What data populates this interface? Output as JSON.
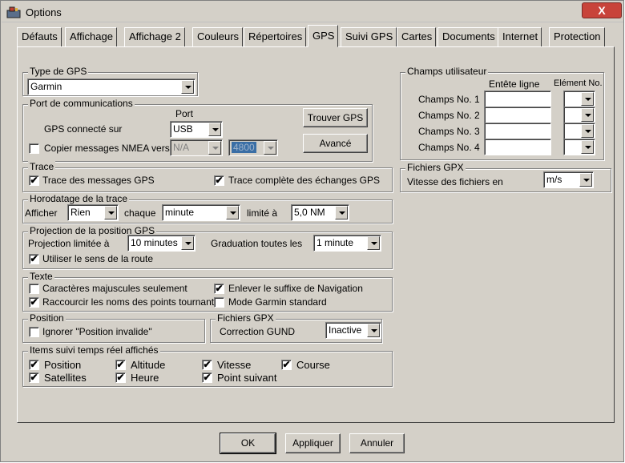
{
  "window": {
    "title": "Options",
    "close_label": "X"
  },
  "tabs": [
    {
      "label": "Défauts"
    },
    {
      "label": "Affichage"
    },
    {
      "label": "Affichage 2"
    },
    {
      "label": "Couleurs"
    },
    {
      "label": "Répertoires"
    },
    {
      "label": "GPS"
    },
    {
      "label": "Suivi GPS"
    },
    {
      "label": "Cartes"
    },
    {
      "label": "Documents"
    },
    {
      "label": "Internet"
    },
    {
      "label": "Protection"
    }
  ],
  "active_tab": "GPS",
  "gps_type": {
    "legend": "Type de GPS",
    "value": "Garmin"
  },
  "port": {
    "legend": "Port de communications",
    "port_header": "Port",
    "connected_label": "GPS connecté sur",
    "port_value": "USB",
    "copy_nmea_label": "Copier messages NMEA vers",
    "copy_nmea_checked": false,
    "nmea_port_value": "N/A",
    "nmea_speed_value": "4800",
    "find_button": "Trouver GPS",
    "advanced_button": "Avancé"
  },
  "trace": {
    "legend": "Trace",
    "gps_messages_label": "Trace des messages GPS",
    "gps_messages_checked": true,
    "full_trace_label": "Trace complète des échanges GPS",
    "full_trace_checked": true
  },
  "timestamp": {
    "legend": "Horodatage de la trace",
    "show_label": "Afficher",
    "show_value": "Rien",
    "each_label": "chaque",
    "each_value": "minute",
    "limit_label": "limité à",
    "limit_value": "5,0 NM"
  },
  "projection": {
    "legend": "Projection de la position GPS",
    "limit_label": "Projection limitée à",
    "limit_value": "10 minutes",
    "graduation_label": "Graduation toutes les",
    "graduation_value": "1 minute",
    "route_label": "Utiliser le sens de la route",
    "route_checked": true
  },
  "text": {
    "legend": "Texte",
    "uppercase_label": "Caractères majuscules seulement",
    "uppercase_checked": false,
    "suffix_label": "Enlever le suffixe de Navigation",
    "suffix_checked": true,
    "shorten_label": "Raccourcir les noms des points tournants",
    "shorten_checked": true,
    "garmin_label": "Mode Garmin standard",
    "garmin_checked": false
  },
  "position": {
    "legend": "Position",
    "ignore_label": "Ignorer \"Position invalide\"",
    "ignore_checked": false
  },
  "gpx_left": {
    "legend": "Fichiers GPX",
    "gund_label": "Correction GUND",
    "gund_value": "Inactive"
  },
  "realtime": {
    "legend": "Items suivi temps réel affichés",
    "items": [
      {
        "label": "Position",
        "checked": true
      },
      {
        "label": "Altitude",
        "checked": true
      },
      {
        "label": "Vitesse",
        "checked": true
      },
      {
        "label": "Course",
        "checked": true
      },
      {
        "label": "Satellites",
        "checked": true
      },
      {
        "label": "Heure",
        "checked": true
      },
      {
        "label": "Point suivant",
        "checked": true
      }
    ]
  },
  "user_fields": {
    "legend": "Champs utilisateur",
    "header_label": "Entête ligne",
    "header_element": "Elément No.",
    "rows": [
      {
        "label": "Champs No. 1",
        "value": "",
        "element": ""
      },
      {
        "label": "Champs No. 2",
        "value": "",
        "element": ""
      },
      {
        "label": "Champs No. 3",
        "value": "",
        "element": ""
      },
      {
        "label": "Champs No. 4",
        "value": "",
        "element": ""
      }
    ]
  },
  "gpx_right": {
    "legend": "Fichiers GPX",
    "speed_label": "Vitesse des fichiers en",
    "speed_value": "m/s"
  },
  "footer": {
    "ok": "OK",
    "apply": "Appliquer",
    "cancel": "Annuler"
  }
}
